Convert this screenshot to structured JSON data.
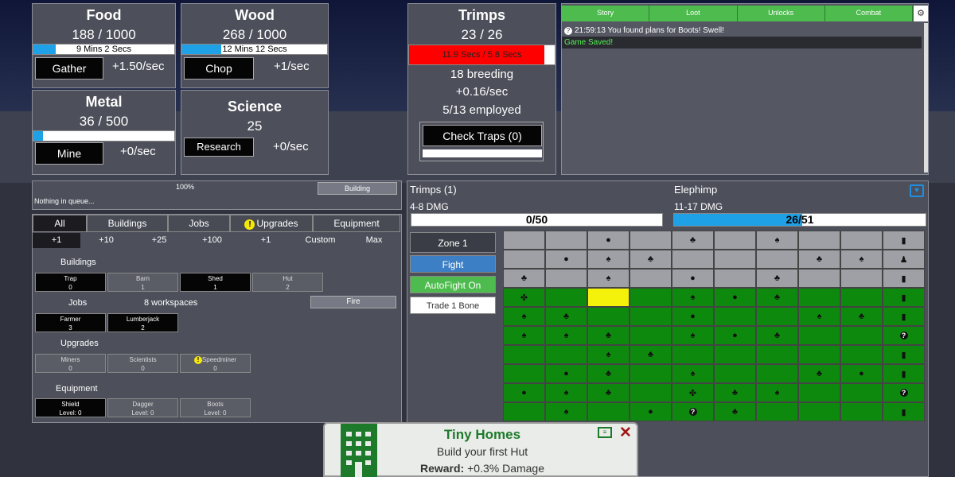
{
  "food": {
    "title": "Food",
    "count": "188 / 1000",
    "timer": "9 Mins 2 Secs",
    "progress": 0.16,
    "button": "Gather",
    "rate": "+1.50/sec"
  },
  "wood": {
    "title": "Wood",
    "count": "268 / 1000",
    "timer": "12 Mins 12 Secs",
    "progress": 0.27,
    "button": "Chop",
    "rate": "+1/sec"
  },
  "metal": {
    "title": "Metal",
    "count": "36 / 500",
    "progress": 0.07,
    "button": "Mine",
    "rate": "+0/sec"
  },
  "science": {
    "title": "Science",
    "count": "25",
    "button": "Research",
    "rate": "+0/sec"
  },
  "trimps": {
    "title": "Trimps",
    "count": "23 / 26",
    "timer": "11.9 Secs / 5.8 Secs",
    "progress": 0.93,
    "breeding": "18 breeding",
    "rate": "+0.16/sec",
    "employed": "5/13 employed",
    "check_traps": "Check Traps (0)"
  },
  "log": {
    "tabs": [
      "Story",
      "Loot",
      "Unlocks",
      "Combat"
    ],
    "entries": [
      {
        "text": "21:59:13 You found plans for Boots! Swell!",
        "color": "#ffffff"
      },
      {
        "text": "Game Saved!",
        "color": "#55ee55"
      }
    ]
  },
  "queue": {
    "percent": "100%",
    "text": "Nothing in queue...",
    "button": "Building"
  },
  "buy_tabs": [
    "All",
    "Buildings",
    "Jobs",
    "Upgrades",
    "Equipment"
  ],
  "buy_amounts": [
    "+1",
    "+10",
    "+25",
    "+100",
    "+1",
    "Custom",
    "Max"
  ],
  "buildings": {
    "header": "Buildings",
    "items": [
      {
        "name": "Trap",
        "count": "0"
      },
      {
        "name": "Barn",
        "count": "1"
      },
      {
        "name": "Shed",
        "count": "1"
      },
      {
        "name": "Hut",
        "count": "2"
      }
    ]
  },
  "jobs": {
    "header": "Jobs",
    "workspaces": "8 workspaces",
    "fire": "Fire",
    "items": [
      {
        "name": "Farmer",
        "count": "3"
      },
      {
        "name": "Lumberjack",
        "count": "2"
      }
    ]
  },
  "upgrades": {
    "header": "Upgrades",
    "items": [
      {
        "name": "Miners",
        "count": "0"
      },
      {
        "name": "Scientists",
        "count": "0"
      },
      {
        "name": "Speedminer",
        "count": "0"
      }
    ]
  },
  "equipment": {
    "header": "Equipment",
    "items": [
      {
        "name": "Shield",
        "level": "Level: 0"
      },
      {
        "name": "Dagger",
        "level": "Level: 0"
      },
      {
        "name": "Boots",
        "level": "Level: 0"
      }
    ]
  },
  "battle": {
    "trimps_label": "Trimps (1)",
    "trimps_dmg": "4-8 DMG",
    "trimps_hp": "0/50",
    "trimps_hp_fraction": 0.0,
    "enemy_name": "Elephimp",
    "enemy_dmg": "11-17 DMG",
    "enemy_hp": "26/51",
    "enemy_hp_fraction": 0.51
  },
  "zone": {
    "label": "Zone 1",
    "fight": "Fight",
    "autofight": "AutoFight On",
    "trade": "Trade 1 Bone"
  },
  "map_grid": [
    [
      "g",
      "g",
      "g:apple",
      "g",
      "g:metal",
      "g",
      "g:tree",
      "g",
      "g",
      "g:book"
    ],
    [
      "g",
      "g:apple",
      "g:tree",
      "g:metal",
      "g",
      "g",
      "g",
      "g:metal",
      "g:tree",
      "g:person"
    ],
    [
      "g:metal",
      "g",
      "g:tree",
      "g",
      "g:apple",
      "g",
      "g:metal",
      "g",
      "g",
      "g:book"
    ],
    [
      "n:gem",
      "n",
      "y",
      "n",
      "n:tree",
      "n:apple",
      "n:metal",
      "n",
      "n",
      "n:book"
    ],
    [
      "n:tree",
      "n:metal",
      "n",
      "n",
      "n:apple",
      "n",
      "n",
      "n:tree",
      "n:metal",
      "n:book"
    ],
    [
      "n:tree",
      "n:tree",
      "n:metal",
      "n",
      "n:tree",
      "n:apple",
      "n:metal",
      "n",
      "n",
      "n:q"
    ],
    [
      "n",
      "n",
      "n:tree",
      "n:metal",
      "n",
      "n",
      "n",
      "n",
      "n",
      "n:book"
    ],
    [
      "n",
      "n:apple",
      "n:metal",
      "n",
      "n:tree",
      "n",
      "n",
      "n:metal",
      "n:apple",
      "n:book"
    ],
    [
      "n:apple",
      "n:tree",
      "n:metal",
      "n",
      "n:gem",
      "n:metal",
      "n:tree",
      "n",
      "n",
      "n:q"
    ],
    [
      "n",
      "n:tree",
      "n",
      "n:apple",
      "n:q",
      "n:metal",
      "n",
      "n",
      "n",
      "n:book"
    ]
  ],
  "achievement": {
    "title": "Tiny Homes",
    "desc": "Build your first Hut",
    "reward_label": "Reward:",
    "reward_value": " +0.3% Damage"
  }
}
